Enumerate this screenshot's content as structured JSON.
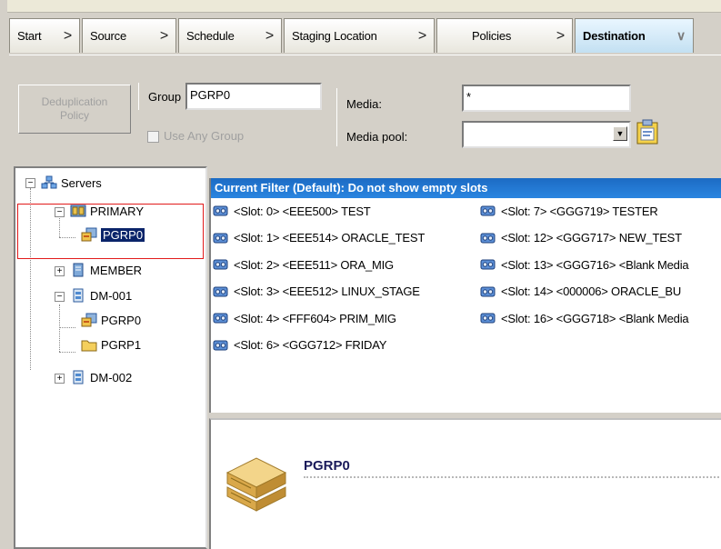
{
  "wizard": {
    "tabs": [
      {
        "label": "Start",
        "chevron": ">"
      },
      {
        "label": "Source",
        "chevron": ">"
      },
      {
        "label": "Schedule",
        "chevron": ">"
      },
      {
        "label": "Staging Location",
        "chevron": ">"
      },
      {
        "label": "Policies",
        "chevron": ">"
      },
      {
        "label": "Destination",
        "chevron": "∨"
      }
    ],
    "active_tab": "Destination"
  },
  "options": {
    "dedup_button": "Deduplication Policy",
    "group_label": "Group",
    "group_value": "PGRP0",
    "use_any_group_label": "Use Any Group",
    "media_label": "Media:",
    "media_value": "*",
    "media_pool_label": "Media pool:",
    "media_pool_value": ""
  },
  "tree": {
    "root": "Servers",
    "primary": "PRIMARY",
    "primary_child": "PGRP0",
    "member": "MEMBER",
    "dm001": "DM-001",
    "dm001_children": [
      "PGRP0",
      "PGRP1"
    ],
    "dm002": "DM-002"
  },
  "slots": {
    "filter": "Current Filter (Default):  Do not show empty slots",
    "left": [
      "<Slot: 0> <EEE500> TEST",
      "<Slot: 1> <EEE514> ORACLE_TEST",
      "<Slot: 2> <EEE511> ORA_MIG",
      "<Slot: 3> <EEE512> LINUX_STAGE",
      "<Slot: 4> <FFF604> PRIM_MIG",
      "<Slot: 6> <GGG712> FRIDAY"
    ],
    "right": [
      "<Slot: 7> <GGG719> TESTER",
      "<Slot: 12> <GGG717> NEW_TEST",
      "<Slot: 13> <GGG716> <Blank Media",
      "<Slot: 14> <000006> ORACLE_BU",
      "<Slot: 16> <GGG718> <Blank Media"
    ]
  },
  "detail": {
    "title": "PGRP0"
  },
  "colors": {
    "filter_bar": "#2a85e0",
    "selection": "#0a246a",
    "highlight_box": "#e21a1a",
    "active_tab": "#c3e0f2"
  }
}
